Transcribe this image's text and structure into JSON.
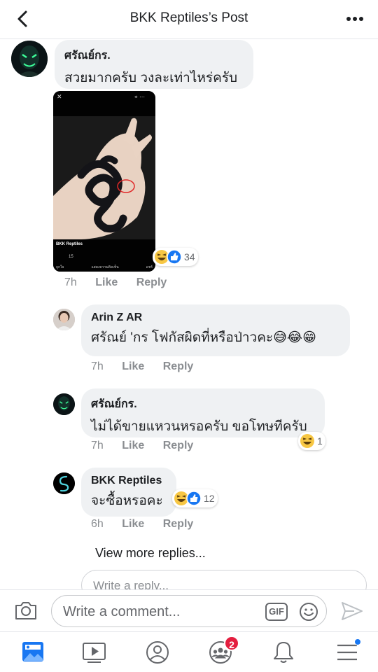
{
  "header": {
    "title": "BKK Reptiles’s Post"
  },
  "comments": [
    {
      "name": "ศรัณย์กร.",
      "text": "สวยมากครับ วงละเท่าไหร่ครับ",
      "time": "7h",
      "like": "Like",
      "reply": "Reply",
      "reaction_count": "34"
    },
    {
      "name": "Arin Z AR",
      "text": "ศรัณย์ 'กร โฟกัสผิดที่หรือป่าวคะ😅😂😁",
      "time": "7h",
      "like": "Like",
      "reply": "Reply"
    },
    {
      "name": "ศรัณย์กร.",
      "text": "ไม่ได้ขายแหวนหรอครับ ขอโทษทีครับ",
      "time": "7h",
      "like": "Like",
      "reply": "Reply",
      "reaction_count": "1"
    },
    {
      "name": "BKK Reptiles",
      "text": "จะซื้อหรอคะ",
      "time": "6h",
      "like": "Like",
      "reply": "Reply",
      "reaction_count": "12"
    }
  ],
  "attachment": {
    "page_name": "BKK Reptiles",
    "reaction_count": "15",
    "actions": [
      "ถูกใจ",
      "แสดงความคิดเห็น",
      "แชร์"
    ]
  },
  "view_more_replies": "View more replies...",
  "reply_placeholder": "Write a reply...",
  "composer": {
    "placeholder": "Write a comment...",
    "gif_label": "GIF"
  },
  "tabs": {
    "notifications_badge": "2"
  },
  "colors": {
    "accent": "#1877f2",
    "bubble": "#eff1f3",
    "badge": "#e41e3f"
  }
}
